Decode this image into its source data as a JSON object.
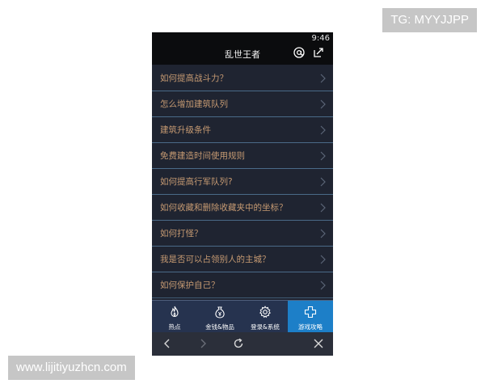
{
  "watermarks": {
    "top_right": "TG: MYYJJPP",
    "bottom_left": "www.lijitiyuzhcn.com"
  },
  "status_bar": {
    "time": "9:46"
  },
  "header": {
    "title": "乱世王者"
  },
  "list": {
    "items": [
      {
        "label": "如何提高战斗力？"
      },
      {
        "label": "怎么增加建筑队列"
      },
      {
        "label": "建筑升级条件"
      },
      {
        "label": "免费建造时间使用规则"
      },
      {
        "label": "如何提高行军队列?"
      },
      {
        "label": "如何收藏和删除收藏夹中的坐标？"
      },
      {
        "label": "如何打怪？"
      },
      {
        "label": "我是否可以占领别人的主城？"
      },
      {
        "label": "如何保护自己？"
      }
    ]
  },
  "tabs": [
    {
      "label": "热点",
      "icon": "flame-icon",
      "active": false
    },
    {
      "label": "金钱&物品",
      "icon": "money-bag-icon",
      "active": false
    },
    {
      "label": "登录&系统",
      "icon": "gear-icon",
      "active": false
    },
    {
      "label": "游戏攻略",
      "icon": "cross-icon",
      "active": true
    }
  ],
  "colors": {
    "list_text": "#c69a72",
    "active_tab": "#1d7fc8",
    "tabbar": "#26334f",
    "background": "#1e2330"
  }
}
